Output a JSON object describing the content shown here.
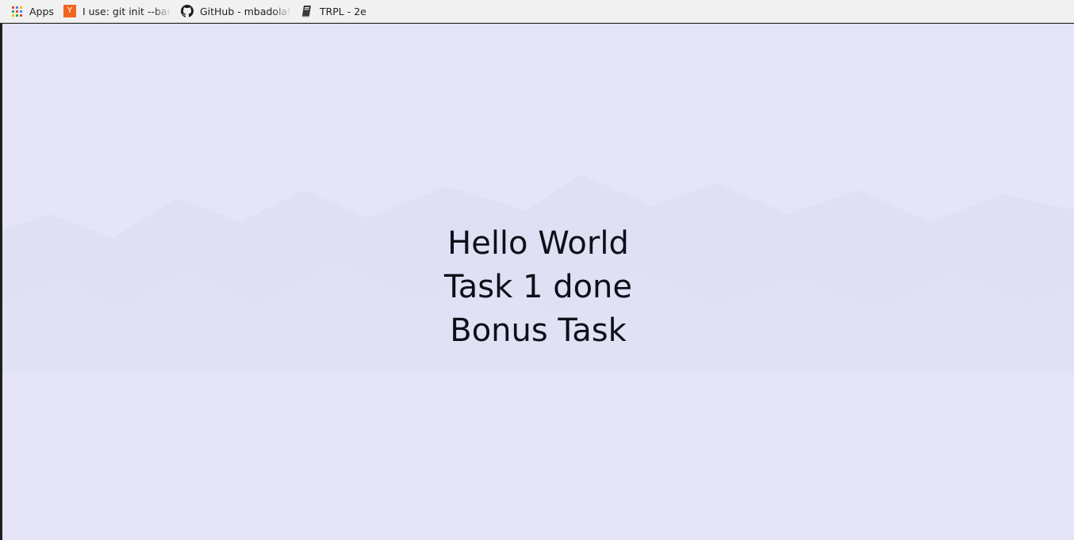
{
  "bookmarks": [
    {
      "label": "Apps",
      "icon": "apps-grid-icon"
    },
    {
      "label": "I use: git init --bare",
      "icon": "y-combinator-icon"
    },
    {
      "label": "GitHub - mbadolato",
      "icon": "github-icon"
    },
    {
      "label": "TRPL - 2e",
      "icon": "book-icon"
    }
  ],
  "colors": {
    "page_background": "#e5e5f7",
    "bookmarks_bar": "#f1f1f1",
    "text": "#0f0f1a",
    "yc_orange": "#f26522"
  },
  "page": {
    "lines": [
      "Hello World",
      "Task 1 done",
      "Bonus Task"
    ]
  }
}
